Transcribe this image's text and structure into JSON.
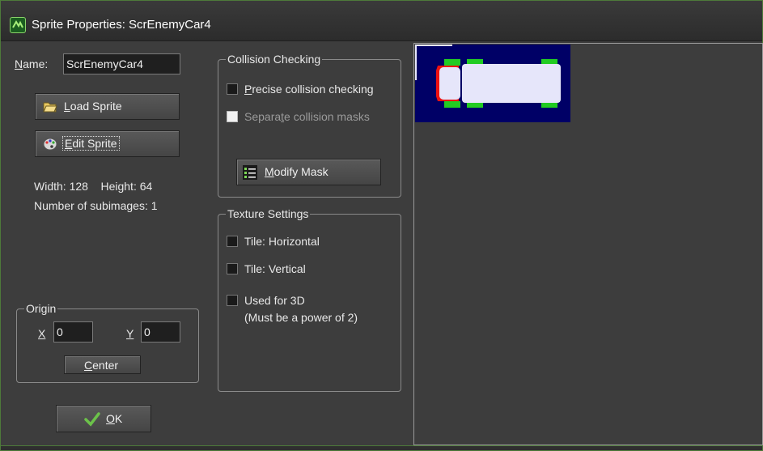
{
  "window": {
    "title": "Sprite Properties: ScrEnemyCar4"
  },
  "name_field": {
    "label_prefix": "",
    "label_accel": "N",
    "label_rest": "ame:",
    "value": "ScrEnemyCar4"
  },
  "buttons": {
    "load_accel": "L",
    "load_rest": "oad Sprite",
    "edit_accel": "E",
    "edit_rest": "dit Sprite",
    "modify_accel": "M",
    "modify_rest": "odify Mask",
    "center_accel": "C",
    "center_rest": "enter",
    "ok_accel": "O",
    "ok_rest": "K"
  },
  "info": {
    "size_text": "Width: 128    Height: 64",
    "subimages_text": "Number of subimages: 1"
  },
  "origin": {
    "title": "Origin",
    "x_label": "X",
    "y_label": "Y",
    "x_value": "0",
    "y_value": "0"
  },
  "collision": {
    "title": "Collision Checking",
    "precise_accel": "P",
    "precise_rest": "recise collision checking",
    "separate_pre": "Separa",
    "separate_accel": "t",
    "separate_rest": "e collision masks",
    "precise_checked": false,
    "separate_checked": false,
    "separate_enabled": false
  },
  "texture": {
    "title": "Texture Settings",
    "tile_h": "Tile: Horizontal",
    "tile_v": "Tile: Vertical",
    "used_3d_line1": "Used for 3D",
    "used_3d_line2": "(Must be a power of 2)"
  },
  "colors": {
    "background": "#3d3d3d",
    "sprite_bg": "#000066",
    "car_body": "#e6e6fa",
    "car_wheels": "#22cc22",
    "car_front": "#ee1111",
    "accent_green": "#4d7a3a"
  },
  "icons": {
    "app": "gamemaker-icon",
    "load": "folder-open-icon",
    "edit": "paint-palette-icon",
    "modify": "mask-list-icon",
    "ok": "checkmark-icon"
  }
}
